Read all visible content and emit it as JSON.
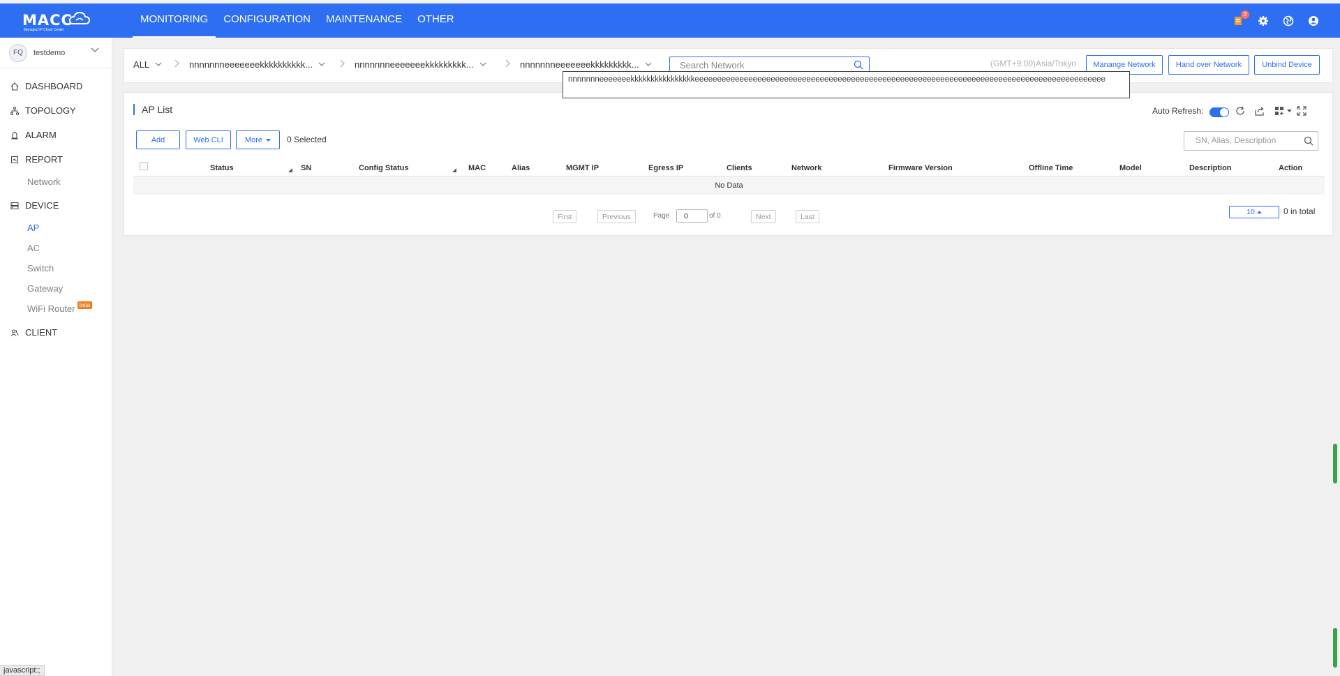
{
  "brand": {
    "logo_text": "MACC",
    "logo_subtitle": "Managed IP Cloud Center"
  },
  "topnav": [
    {
      "label": "MONITORING",
      "active": true
    },
    {
      "label": "CONFIGURATION",
      "active": false
    },
    {
      "label": "MAINTENANCE",
      "active": false
    },
    {
      "label": "OTHER",
      "active": false
    }
  ],
  "top_icons": {
    "notification_badge": "3",
    "icons": [
      "notification-icon",
      "settings-gear-icon",
      "globe-icon",
      "user-account-icon"
    ]
  },
  "sidebar": {
    "user": {
      "avatar_initials": "FQ",
      "name": "testdemo"
    },
    "menu": [
      {
        "label": "DASHBOARD",
        "icon": "home-icon"
      },
      {
        "label": "TOPOLOGY",
        "icon": "topology-icon"
      },
      {
        "label": "ALARM",
        "icon": "alarm-icon"
      },
      {
        "label": "REPORT",
        "icon": "report-icon"
      },
      {
        "label": "DEVICE",
        "icon": "device-icon"
      },
      {
        "label": "CLIENT",
        "icon": "client-icon"
      }
    ],
    "report_sub": [
      "Network"
    ],
    "device_sub": [
      "AP",
      "AC",
      "Switch",
      "Gateway",
      "WiFi Router"
    ],
    "device_active": "AP",
    "beta_label": "beta"
  },
  "filterbar": {
    "all_label": "ALL",
    "crumbs": [
      "nnnnnnneeeeeeekkkkkkkkkk...",
      "nnnnnnneeeeeeekkkkkkkkk...",
      "nnnnnnneeeeeeekkkkkkkkk..."
    ],
    "search_placeholder": "Search Network",
    "timezone": "(GMT+9:00)Asia/Tokyo",
    "buttons": [
      "Manange Network",
      "Hand over Network",
      "Unbind Device"
    ]
  },
  "tooltip_text": "nnnnnnneeeeeeekkkkkkkkkkkkkkkkeeeeeeeeeeeeeeeeeeeeeeeeeeeeeeeeeeeeeeeeeeeeeeeeeeeeeeeeeeeeeeeeeeeeeeeeeeeeeeeeeeeeeeeeeeee",
  "ap_list": {
    "title": "AP List",
    "auto_refresh_label": "Auto Refresh:",
    "auto_refresh_on": true,
    "buttons": {
      "add": "Add",
      "web_cli": "Web CLI",
      "more": "More"
    },
    "selected_text": "0 Selected",
    "search_placeholder": "SN, Alias, Description",
    "columns": [
      "Status",
      "SN",
      "Config Status",
      "MAC",
      "Alias",
      "MGMT IP",
      "Egress IP",
      "Clients",
      "Network",
      "Firmware Version",
      "Offline Time",
      "Model",
      "Description",
      "Action"
    ],
    "rows": [],
    "empty_text": "No Data",
    "pagination": {
      "first": "First",
      "previous": "Previous",
      "page_label": "Page",
      "page_value": "0",
      "of_label": "of 0",
      "next": "Next",
      "last": "Last",
      "page_size": "10",
      "total": "0 in total"
    }
  },
  "status_bar_text": "javascript:;",
  "colors": {
    "primary": "#2d6ef2",
    "badge": "#ff6f61",
    "beta": "#f07c1c",
    "page_bg": "#f0f0f0"
  }
}
